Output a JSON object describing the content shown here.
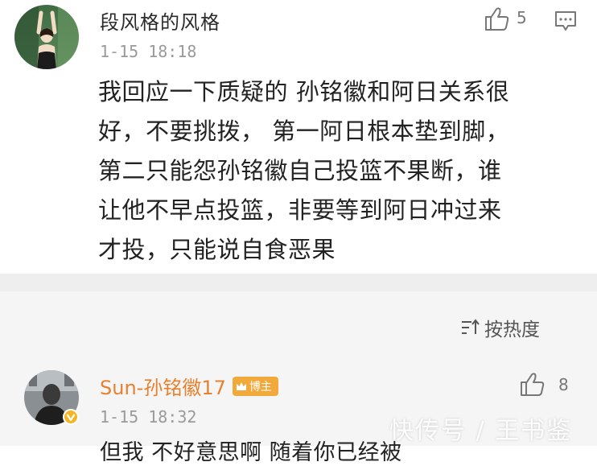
{
  "comments": [
    {
      "author": "段风格的风格",
      "time": "1-15 18:18",
      "likes": "5",
      "body_lines": [
        "我回应一下质疑的 孙铭徽和阿日关系很",
        "好，不要挑拨， 第一阿日根本垫到脚，",
        "第二只能怨孙铭徽自己投篮不果断，谁",
        "让他不早点投篮，非要等到阿日冲过来",
        "才投，只能说自食恶果"
      ]
    },
    {
      "author": "Sun-孙铭徽17",
      "badge": "博主",
      "time": "1-15 18:32",
      "likes": "8",
      "body_partial": "但我 不好意思啊 随着你已经被"
    }
  ],
  "sort": {
    "label": "按热度"
  },
  "watermark": "快传号 / 王书鉴",
  "colors": {
    "author_orange": "#e7812e",
    "badge_orange": "#f0a93a",
    "text_main": "#222222",
    "text_meta": "#9a9a9a",
    "background_gray": "#f5f5f5"
  },
  "icons": {
    "like": "thumbs-up-icon",
    "reply": "comment-bubble-icon",
    "sort": "sort-icon",
    "verified": "verified-v-icon",
    "badge": "crown-icon"
  }
}
